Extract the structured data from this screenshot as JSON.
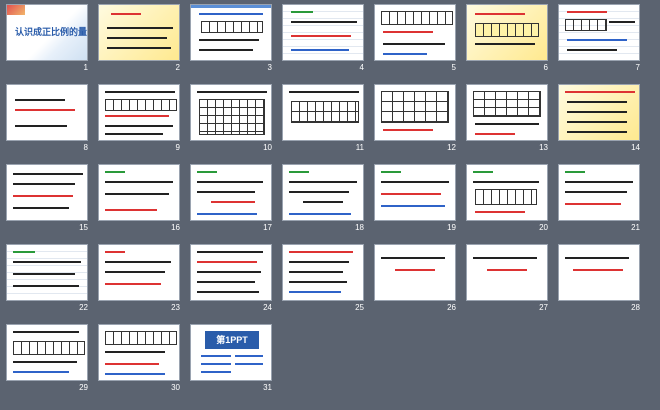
{
  "viewer": {
    "mode": "slide-sorter"
  },
  "slides": [
    {
      "number": "1",
      "title": "认识成正比例的量"
    },
    {
      "number": "2"
    },
    {
      "number": "3"
    },
    {
      "number": "4"
    },
    {
      "number": "5"
    },
    {
      "number": "6"
    },
    {
      "number": "7"
    },
    {
      "number": "8"
    },
    {
      "number": "9"
    },
    {
      "number": "10"
    },
    {
      "number": "11"
    },
    {
      "number": "12"
    },
    {
      "number": "13"
    },
    {
      "number": "14"
    },
    {
      "number": "15"
    },
    {
      "number": "16"
    },
    {
      "number": "17"
    },
    {
      "number": "18"
    },
    {
      "number": "19"
    },
    {
      "number": "20"
    },
    {
      "number": "21"
    },
    {
      "number": "22"
    },
    {
      "number": "23"
    },
    {
      "number": "24"
    },
    {
      "number": "25"
    },
    {
      "number": "26"
    },
    {
      "number": "27"
    },
    {
      "number": "28"
    },
    {
      "number": "29"
    },
    {
      "number": "30"
    },
    {
      "number": "31",
      "logo": "第1PPT"
    }
  ]
}
